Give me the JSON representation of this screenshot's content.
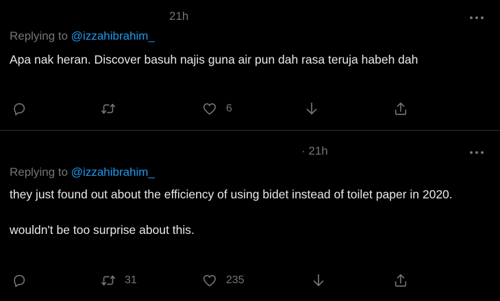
{
  "colors": {
    "background": "#000000",
    "text": "#e7e9ea",
    "muted": "#71767b",
    "link": "#1d9bf0",
    "divider": "#2f3336"
  },
  "tweets": [
    {
      "time": "21h",
      "replying_prefix": "Replying to ",
      "replying_handle": "@izzahibrahim_",
      "text": "Apa nak heran. Discover basuh najis guna air pun dah rasa teruja habeh dah",
      "actions": {
        "reply": {
          "icon": "reply-icon",
          "count": ""
        },
        "retweet": {
          "icon": "retweet-icon",
          "count": ""
        },
        "like": {
          "icon": "heart-icon",
          "count": "6"
        },
        "download": {
          "icon": "download-arrow-icon",
          "count": ""
        },
        "share": {
          "icon": "share-icon",
          "count": ""
        }
      },
      "more_icon": "more-dots-icon"
    },
    {
      "time": "· 21h",
      "replying_prefix": "Replying to ",
      "replying_handle": "@izzahibrahim_",
      "text": "they just found out about the efficiency of using bidet instead of toilet paper in 2020.\n\nwouldn't be too surprise about this.",
      "actions": {
        "reply": {
          "icon": "reply-icon",
          "count": ""
        },
        "retweet": {
          "icon": "retweet-icon",
          "count": "31"
        },
        "like": {
          "icon": "heart-icon",
          "count": "235"
        },
        "download": {
          "icon": "download-arrow-icon",
          "count": ""
        },
        "share": {
          "icon": "share-icon",
          "count": ""
        }
      },
      "more_icon": "more-dots-icon"
    }
  ]
}
